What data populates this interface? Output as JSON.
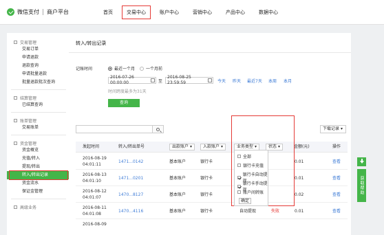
{
  "header": {
    "brand": "微信支付",
    "sub": "商户平台",
    "nav": [
      "首页",
      "交易中心",
      "账户中心",
      "营销中心",
      "产品中心",
      "数据中心"
    ],
    "active_nav": "交易中心"
  },
  "sidebar": {
    "groups": [
      {
        "title": "交易管理",
        "items": [
          "交易订单",
          "申请退款",
          "退款查询",
          "申请批量退款",
          "批量退款批次查询"
        ]
      },
      {
        "title": "结算管理",
        "items": [
          "已结算查询"
        ]
      },
      {
        "title": "账单管理",
        "items": [
          "交易账单"
        ]
      },
      {
        "title": "资金管理",
        "items": [
          "资金概览",
          "充值/转入",
          "提现/转出",
          "转入/转出记录",
          "资金流水",
          "保证金管理"
        ]
      },
      {
        "title": "高级业务",
        "items": []
      }
    ],
    "active_item": "转入/转出记录"
  },
  "main": {
    "title": "转入/转出记录",
    "time_label": "记账时间",
    "radio_recent": "最近一个月",
    "radio_month": "一个月前",
    "date_start": "2016-07-26 00:00:00",
    "to": "至",
    "date_end": "2016-08-25 23:59:59",
    "quick": [
      "今天",
      "昨天",
      "最近7天",
      "本周",
      "本月"
    ],
    "hint": "时间跨度最多为31天",
    "query_btn": "查询",
    "download_btn": "下载记录",
    "table": {
      "headers": {
        "time": "发起时间",
        "order": "转入/转出单号",
        "out_account": "出款账户",
        "in_account": "入款账户",
        "biz_type": "业务类型",
        "status": "状态",
        "amount": "金额(元)",
        "op": "操作"
      },
      "rows": [
        {
          "date": "2016-08-19",
          "time": "04:01:11",
          "order": "1471...0142",
          "out": "基本账户",
          "in": "银行卡",
          "type": "",
          "status": "",
          "amount": "0.01",
          "op": "查看"
        },
        {
          "date": "2016-08-13",
          "time": "04:01:10",
          "order": "1471...0201",
          "out": "基本账户",
          "in": "银行卡",
          "type": "",
          "status": "",
          "amount": "0.01",
          "op": "查看"
        },
        {
          "date": "2016-08-12",
          "time": "04:01:07",
          "order": "1470...8127",
          "out": "基本账户",
          "in": "银行卡",
          "type": "",
          "status": "",
          "amount": "0.02",
          "op": "查看"
        },
        {
          "date": "2016-08-11",
          "time": "04:01:08",
          "order": "1470...4116",
          "out": "基本账户",
          "in": "银行卡",
          "type": "自动提现",
          "status": "失败",
          "amount": "0.01",
          "op": "查看"
        },
        {
          "date": "2016-08-09",
          "time": "",
          "order": "",
          "out": "",
          "in": "",
          "type": "",
          "status": "",
          "amount": "",
          "op": ""
        }
      ]
    },
    "filter": {
      "options": [
        {
          "label": "全部",
          "checked": false
        },
        {
          "label": "银行卡充值",
          "checked": false
        },
        {
          "label": "银行卡自动提现",
          "checked": true
        },
        {
          "label": "银行卡手动提现",
          "checked": true
        },
        {
          "label": "账户间转账",
          "checked": false
        }
      ],
      "ok": "确定"
    }
  },
  "side_float": {
    "help": "获取帮助"
  }
}
